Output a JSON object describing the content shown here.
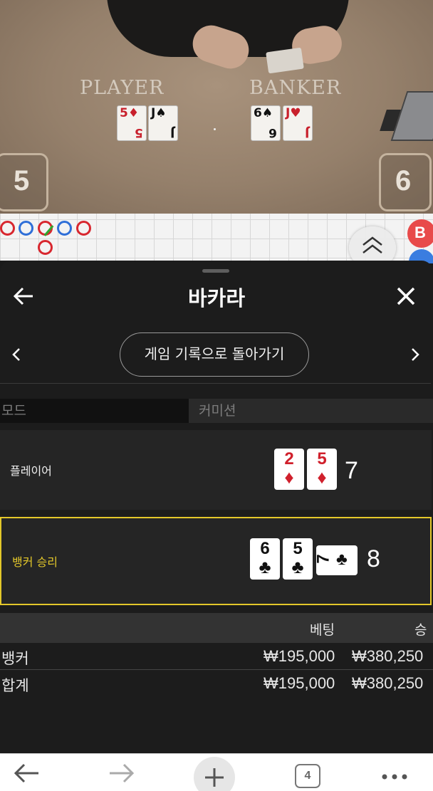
{
  "video": {
    "player_label": "PLAYER",
    "banker_label": "BANKER",
    "player_score": "5",
    "banker_score": "6",
    "player_cards": [
      {
        "rank": "5",
        "suit": "♦",
        "color": "red"
      },
      {
        "rank": "J",
        "suit": "♠",
        "color": "black"
      }
    ],
    "banker_cards": [
      {
        "rank": "6",
        "suit": "♠",
        "color": "black"
      },
      {
        "rank": "J",
        "suit": "♥",
        "color": "red"
      }
    ]
  },
  "road_map": {
    "side_badge": "B",
    "row1": [
      "B",
      "P",
      "B",
      "P",
      "B"
    ],
    "row2": [
      "B"
    ]
  },
  "sheet": {
    "title": "바카라",
    "history_button": "게임 기록으로 돌아가기",
    "mode_label": "모드",
    "commission_label": "커미션",
    "player": {
      "label": "플레이어",
      "total": "7",
      "cards": [
        {
          "rank": "2",
          "suit": "♦",
          "color": "red"
        },
        {
          "rank": "5",
          "suit": "♦",
          "color": "red"
        }
      ]
    },
    "banker": {
      "label": "뱅커 승리",
      "total": "8",
      "cards": [
        {
          "rank": "6",
          "suit": "♣",
          "color": "black"
        },
        {
          "rank": "5",
          "suit": "♣",
          "color": "black"
        },
        {
          "rank": "7",
          "suit": "♣",
          "color": "black"
        }
      ]
    },
    "bets": {
      "header_bet": "베팅",
      "header_win": "승",
      "rows": [
        {
          "name": "뱅커",
          "bet": "₩195,000",
          "win": "₩380,250"
        },
        {
          "name": "합계",
          "bet": "₩195,000",
          "win": "₩380,250"
        }
      ]
    }
  },
  "browser": {
    "tab_count": "4"
  },
  "colors": {
    "winner_border": "#e3c72a",
    "card_red": "#d0202c",
    "road_player": "#2f6fd8",
    "road_banker": "#d8272f"
  }
}
